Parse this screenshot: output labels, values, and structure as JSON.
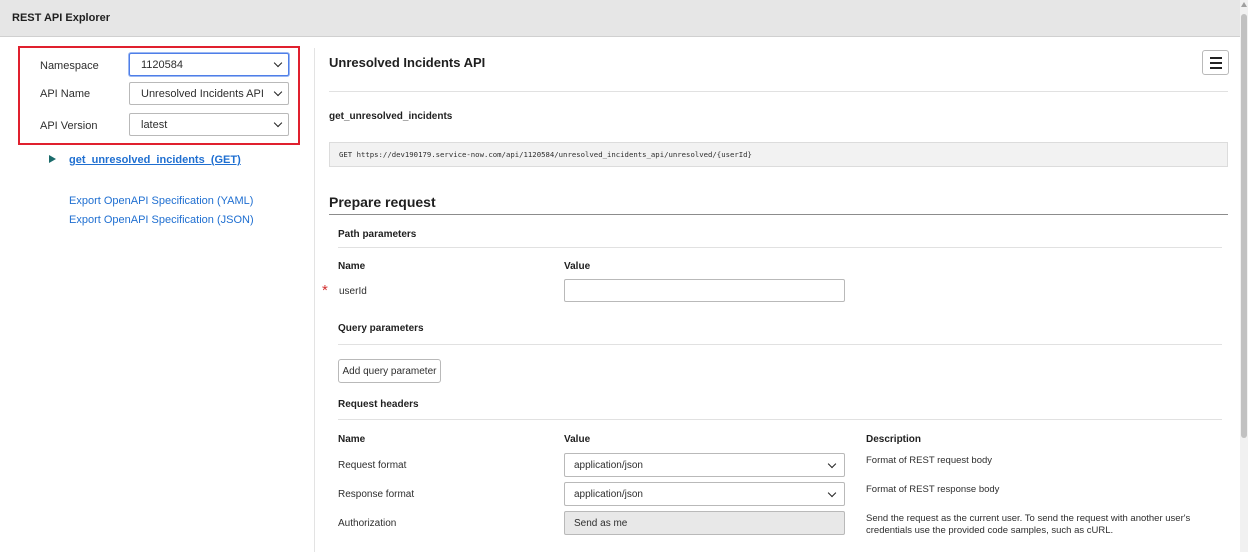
{
  "app": {
    "title": "REST API Explorer"
  },
  "sidebar": {
    "fields": [
      {
        "label": "Namespace",
        "value": "1120584"
      },
      {
        "label": "API Name",
        "value": "Unresolved Incidents API"
      },
      {
        "label": "API Version",
        "value": "latest"
      }
    ],
    "method_link": "get_unresolved_incidents  (GET)",
    "exports": [
      "Export OpenAPI Specification (YAML)",
      "Export OpenAPI Specification (JSON)"
    ]
  },
  "main": {
    "api_title": "Unresolved Incidents API",
    "endpoint_name": "get_unresolved_incidents",
    "endpoint_url": "GET https://dev190179.service-now.com/api/1120584/unresolved_incidents_api/unresolved/{userId}",
    "prepare_request": "Prepare request",
    "path_params": {
      "heading": "Path parameters",
      "col_name": "Name",
      "col_value": "Value",
      "rows": [
        {
          "name": "userId",
          "value": "",
          "required_marker": "*"
        }
      ]
    },
    "query_params": {
      "heading": "Query parameters",
      "add_button": "Add query parameter"
    },
    "request_headers": {
      "heading": "Request headers",
      "col_name": "Name",
      "col_value": "Value",
      "col_desc": "Description",
      "rows": [
        {
          "name": "Request format",
          "value": "application/json",
          "description": "Format of REST request body"
        },
        {
          "name": "Response format",
          "value": "application/json",
          "description": "Format of REST response body"
        },
        {
          "name": "Authorization",
          "value": "Send as me",
          "description_line1": "Send the request as the current user. To send the request with another user's",
          "description_line2": "credentials use the provided code samples, such as cURL."
        }
      ]
    }
  },
  "colors": {
    "highlight_border": "#e0202e",
    "link": "#1f6fd1",
    "required": "#d32f2f",
    "focus": "#4f7ee8"
  }
}
